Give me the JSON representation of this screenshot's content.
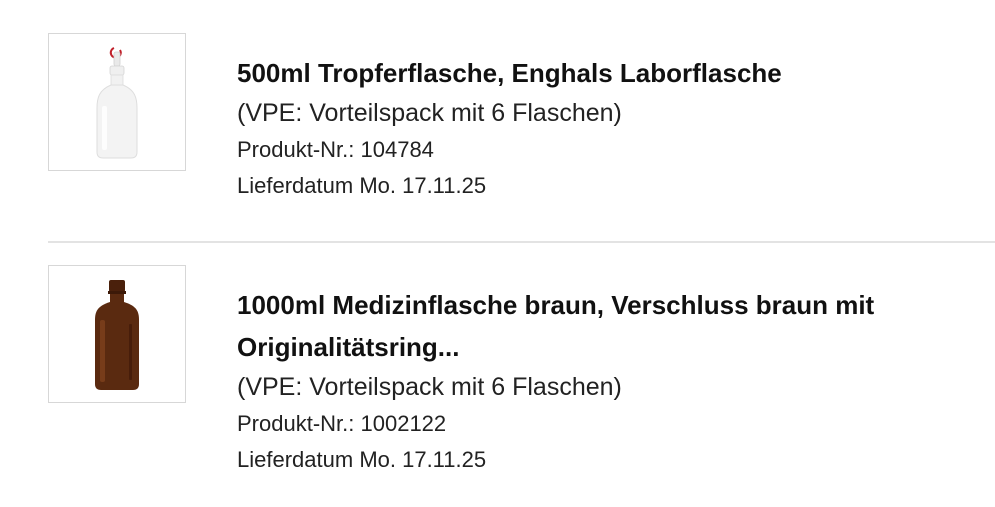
{
  "products": [
    {
      "title": "500ml Tropferflasche, Enghals Laborflasche",
      "pack": "(VPE: Vorteilspack mit 6 Flaschen)",
      "product_no_label": "Produkt-Nr.:",
      "product_no": "104784",
      "delivery_label": "Lieferdatum",
      "delivery_date": "Mo. 17.11.25",
      "image_icon": "dropper-bottle-white-icon"
    },
    {
      "title": "1000ml Medizinflasche braun, Verschluss braun mit Originalitätsring...",
      "pack": "(VPE: Vorteilspack mit 6 Flaschen)",
      "product_no_label": "Produkt-Nr.:",
      "product_no": "1002122",
      "delivery_label": "Lieferdatum",
      "delivery_date": "Mo. 17.11.25",
      "image_icon": "amber-medicine-bottle-icon"
    }
  ],
  "colors": {
    "divider": "#e3e3e3",
    "thumb_border": "#d7d7d7",
    "amber": "#5a2a10",
    "cap_red": "#c0202a"
  }
}
